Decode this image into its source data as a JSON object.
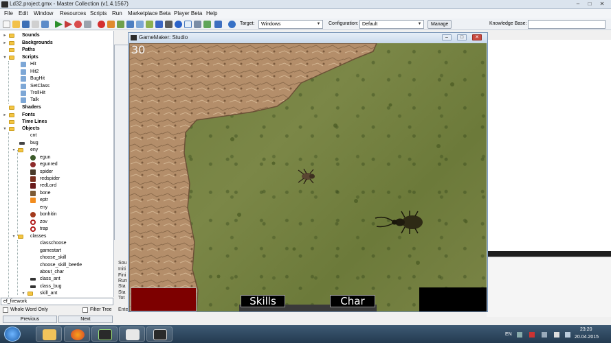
{
  "window": {
    "title": "Ld32.project.gmx  -  Master Collection (v1.4.1567)",
    "controls": [
      "–",
      "□",
      "✕"
    ]
  },
  "menu": [
    "File",
    "Edit",
    "Window",
    "Resources",
    "Scripts",
    "Run",
    "Marketplace Beta",
    "Player Beta",
    "Help"
  ],
  "toolbar": {
    "target_label": "Target:",
    "target_value": "Windows",
    "config_label": "Configuration:",
    "config_value": "Default",
    "manage_label": "Manage",
    "kb_label": "Knowledge Base:"
  },
  "tree": {
    "sounds": "Sounds",
    "backgrounds": "Backgrounds",
    "paths": "Paths",
    "scripts": "Scripts",
    "script_items": [
      "Hit",
      "Hit2",
      "BugHit",
      "SetClass",
      "TrollHit",
      "Talk"
    ],
    "shaders": "Shaders",
    "fonts": "Fonts",
    "timelines": "Time Lines",
    "objects": "Objects",
    "object_items": [
      "cnt",
      "bug"
    ],
    "eny_folder": "eny",
    "eny_items": [
      "egun",
      "egunred",
      "spider",
      "redspider",
      "redLord",
      "bone",
      "eptr",
      "eny",
      "bonhitin",
      "zov",
      "trap"
    ],
    "classes_folder": "classes",
    "classes_items": [
      "classchoose",
      "gamestart",
      "choose_skill",
      "choose_skill_beetle",
      "about_char",
      "class_ant",
      "class_bug"
    ],
    "skill_folder": "skill_ant"
  },
  "search": {
    "value": "ef_firework",
    "whole_word": "Whole Word Only",
    "filter_tree": "Filter Tree",
    "previous": "Previous",
    "next": "Next"
  },
  "compile_log": [
    "Sou",
    "Initi",
    "Fini",
    "Run",
    "Sta",
    "Sta",
    "Tot",
    "Entering main loop."
  ],
  "game": {
    "title": "GameMaker: Studio",
    "counter": "30",
    "skills_label": "Skills",
    "char_label": "Char"
  },
  "taskbar": {
    "lang": "EN",
    "time": "23:20",
    "date": "20.04.2015",
    "apps": [
      "start-orb",
      "file-explorer",
      "firefox",
      "gamemaker-studio",
      "xm-play",
      "gamemaker-runner"
    ]
  },
  "colors": {
    "grass": "#6f7d3e",
    "rock": "#b48e6a",
    "hud_red": "#7d0000",
    "hud_black": "#000000"
  }
}
